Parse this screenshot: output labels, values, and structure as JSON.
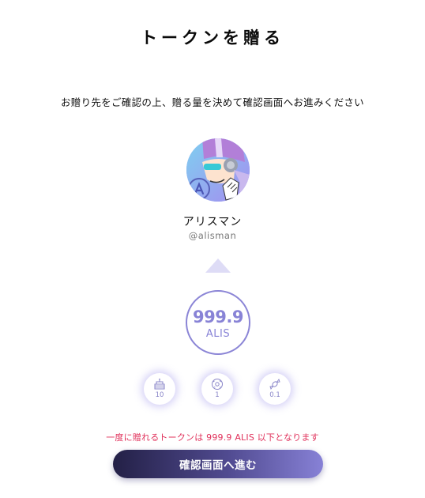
{
  "page": {
    "title": "トークンを贈る",
    "instruction": "お贈り先をご確認の上、贈る量を決めて確認画面へお進みください"
  },
  "recipient": {
    "display_name": "アリスマン",
    "handle": "@alisman"
  },
  "amount": {
    "value": "999.9",
    "unit": "ALIS"
  },
  "quick_amounts": [
    {
      "label": "10",
      "icon": "cake-icon"
    },
    {
      "label": "1",
      "icon": "donut-icon"
    },
    {
      "label": "0.1",
      "icon": "candy-icon"
    }
  ],
  "limit_note": "一度に贈れるトークンは 999.9 ALIS 以下となります",
  "confirm_button_label": "確認画面へ進む",
  "colors": {
    "accent": "#8883d6",
    "warning": "#e0305a",
    "button_gradient_start": "#232046",
    "button_gradient_end": "#8781d6"
  }
}
